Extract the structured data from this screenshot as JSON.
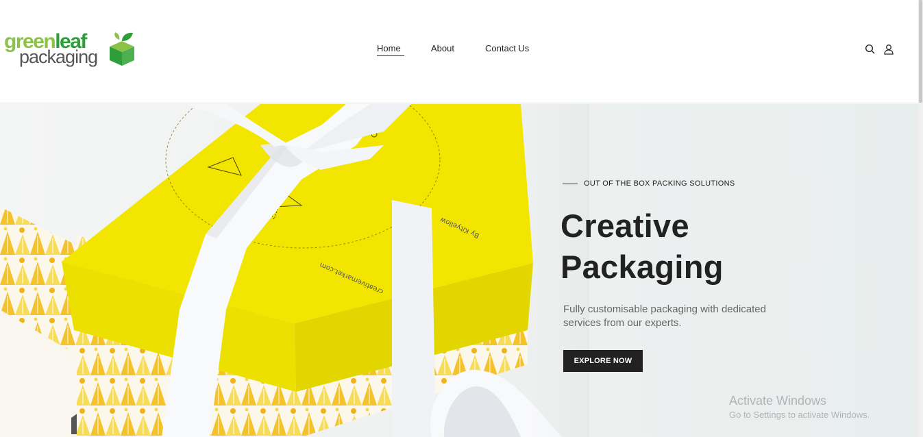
{
  "header": {
    "logo": {
      "word1a": "green",
      "word1b": "leaf",
      "word2": "packaging"
    },
    "nav": [
      {
        "label": "Home",
        "active": true
      },
      {
        "label": "About"
      },
      {
        "label": "Contact Us"
      }
    ],
    "icons": [
      "search-icon",
      "user-icon"
    ]
  },
  "hero": {
    "eyebrow": "OUT OF THE BOX PACKING SOLUTIONS",
    "headline_line1": "Creative",
    "headline_line2": "Packaging",
    "subtitle": "Fully customisable packaging with dedicated services from our experts.",
    "cta_label": "EXPLORE NOW",
    "image_text_1": "By Kityellow",
    "image_text_2": "creativemarket.com"
  },
  "watermark": {
    "line1": "Activate Windows",
    "line2": "Go to Settings to activate Windows."
  },
  "colors": {
    "logo_light_green": "#8bc34a",
    "logo_dark_green": "#2e9e3a",
    "box_yellow": "#f2e600",
    "text_dark": "#222222",
    "button_bg": "#222222"
  }
}
